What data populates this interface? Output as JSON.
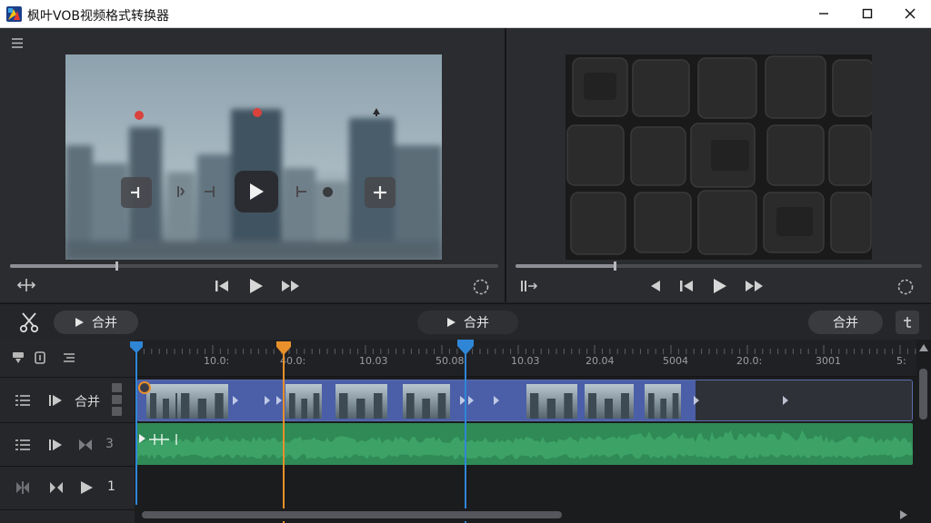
{
  "window": {
    "title": "枫叶VOB视频格式转换器",
    "controls": [
      "minimize-icon",
      "maximize-icon",
      "close-icon"
    ]
  },
  "toolbar": {
    "merge_left_label": "合并",
    "merge_center_label": "合并",
    "merge_right_label": "合并"
  },
  "timeline": {
    "ruler_labels": [
      "10.0:",
      "40.0:",
      "10.03",
      "50.08",
      "10.03",
      "20.04",
      "5004",
      "20.0:",
      "3001",
      "5:"
    ],
    "tracks": [
      {
        "name": "video",
        "label": "合并"
      },
      {
        "name": "audio",
        "label": "3"
      },
      {
        "name": "extra",
        "label": "1"
      }
    ]
  },
  "colors": {
    "accent_blue": "#2f86d6",
    "accent_orange": "#e8902a",
    "clip_blue": "#4a5fa8",
    "audio_green": "#2f8a55",
    "panel_bg": "#2b2c2f"
  }
}
